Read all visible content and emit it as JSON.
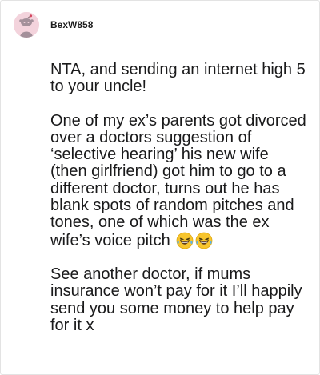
{
  "comment": {
    "username": "BexW858",
    "avatar_icon": "reddit-snoo-avatar-icon",
    "accent_color": "#f3d3dc",
    "paragraphs": [
      "NTA, and sending an internet high 5 to your uncle!",
      "One of my ex’s parents got divorced over a doctors suggestion of ‘selective hearing’ his new wife (then girlfriend) got him to go to a different doctor, turns out he has blank spots of random pitches and tones, one of which was the ex wife’s voice pitch",
      "See another doctor, if mums insurance won’t pay for it I’ll happily send you some money to help pay for it x"
    ],
    "emoji_icons": [
      "laughing-tears-emoji-icon",
      "laughing-tears-emoji-icon"
    ]
  }
}
